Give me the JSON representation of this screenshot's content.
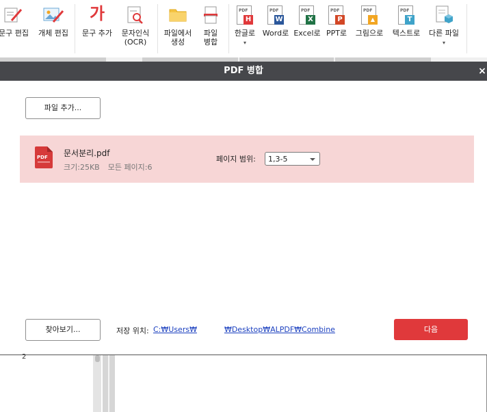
{
  "ribbon": {
    "items": [
      {
        "label": "문구 편집",
        "icon": "edit-text-icon"
      },
      {
        "label": "개체 편집",
        "icon": "edit-object-icon"
      },
      {
        "label": "문구 추가",
        "icon": "add-text-icon",
        "glyph": "가"
      },
      {
        "label": "문자인식",
        "label2": "(OCR)",
        "icon": "ocr-icon"
      },
      {
        "label": "파일에서",
        "label2": "생성",
        "icon": "folder-icon"
      },
      {
        "label": "파일",
        "label2": "병합",
        "icon": "merge-icon"
      },
      {
        "label": "한글로",
        "icon": "hwp-icon",
        "badge": "H",
        "color": "#e0393b",
        "caret": "▾"
      },
      {
        "label": "Word로",
        "icon": "word-icon",
        "badge": "W",
        "color": "#2b579a"
      },
      {
        "label": "Excel로",
        "icon": "excel-icon",
        "badge": "X",
        "color": "#217346"
      },
      {
        "label": "PPT로",
        "icon": "ppt-icon",
        "badge": "P",
        "color": "#d24726"
      },
      {
        "label": "그림으로",
        "icon": "image-icon",
        "badge": "▲",
        "color": "#f2a623"
      },
      {
        "label": "텍스트로",
        "icon": "text-icon",
        "badge": "T",
        "color": "#3fa3c9"
      },
      {
        "label": "다른 파일",
        "icon": "other-file-icon",
        "caret": "▾"
      }
    ],
    "tag": "PDF"
  },
  "dialog": {
    "title": "PDF 병합",
    "close": "×",
    "add_file_label": "파일 추가...",
    "file": {
      "name": "문서분리.pdf",
      "size": "크기:25KB",
      "pages": "모든 페이지:6",
      "icon_text": "PDF"
    },
    "page_range_label": "페이지 범위:",
    "page_range_value": "1,3-5",
    "browse_label": "찾아보기...",
    "save_location_label": "저장 위치:",
    "save_path_start": "C:₩Users₩",
    "save_path_end": "₩Desktop₩ALPDF₩Combine",
    "next_label": "다음"
  },
  "viewer": {
    "page_number": "2"
  },
  "colors": {
    "accent": "#e0393b",
    "title_bar": "#46474b",
    "file_row": "#f7d6d6",
    "link": "#1a3fbf"
  }
}
